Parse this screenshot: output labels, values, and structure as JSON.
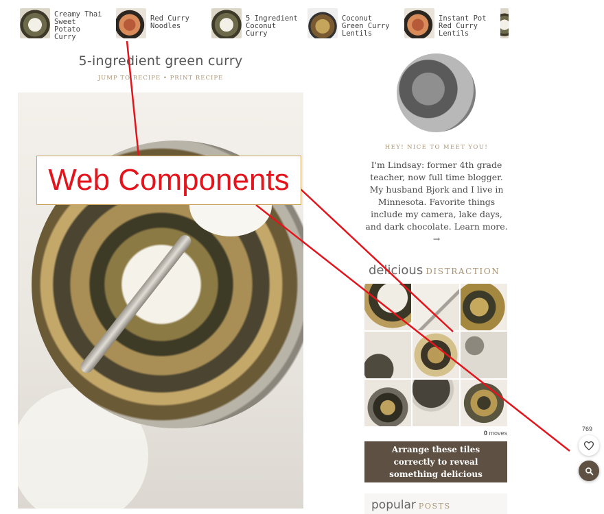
{
  "related_posts": [
    {
      "title": "Creamy Thai Sweet Potato Curry"
    },
    {
      "title": "Red Curry Noodles"
    },
    {
      "title": "5 Ingredient Coconut Curry"
    },
    {
      "title": "Coconut Green Curry Lentils"
    },
    {
      "title": "Instant Pot Red Curry Lentils"
    }
  ],
  "post": {
    "title": "5-ingredient green curry",
    "jump_link": "JUMP TO RECIPE",
    "separator": "•",
    "print_link": "PRINT RECIPE"
  },
  "annotation": {
    "label": "Web Components",
    "color": "#e3141b"
  },
  "sidebar": {
    "greeting": "HEY! NICE TO MEET YOU!",
    "bio": "I'm Lindsay: former 4th grade teacher, now full time blogger. My husband Bjork and I live in Minnesota. Favorite things include my camera, lake days, and dark chocolate.",
    "learn_more": "Learn more. →",
    "widget_title": "delicious",
    "widget_subtitle": "DISTRACTION",
    "moves_count": "0",
    "moves_label": "moves",
    "cta": "Arrange these tiles correctly to reveal something delicious",
    "popular_title": "popular",
    "popular_subtitle": "POSTS"
  },
  "floating": {
    "favorites_count": "769",
    "favorite_icon": "heart-icon",
    "search_icon": "search-icon"
  },
  "colors": {
    "accent": "#a89373",
    "button_dark": "#5e5042"
  }
}
